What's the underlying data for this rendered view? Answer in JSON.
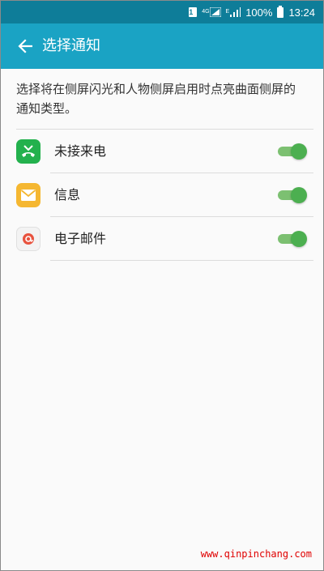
{
  "status_bar": {
    "sim_label": "1",
    "net_4g": "4G",
    "net_e": "E",
    "battery_pct": "100%",
    "time": "13:24"
  },
  "toolbar": {
    "back_icon": "arrow-left-icon",
    "title": "选择通知"
  },
  "description": "选择将在侧屏闪光和人物侧屏启用时点亮曲面侧屏的通知类型。",
  "items": [
    {
      "label": "未接来电",
      "icon": "missed-call-icon",
      "enabled": true
    },
    {
      "label": "信息",
      "icon": "message-icon",
      "enabled": true
    },
    {
      "label": "电子邮件",
      "icon": "email-icon",
      "enabled": true
    }
  ],
  "watermark": "www.qinpinchang.com",
  "colors": {
    "status_bar": "#0e7d99",
    "toolbar": "#1aa3c4",
    "toggle_on": "#4caf50",
    "missed_call_icon": "#23b14d",
    "message_icon": "#f5b731",
    "email_icon": "#f3f3f3",
    "watermark": "#e00000"
  }
}
